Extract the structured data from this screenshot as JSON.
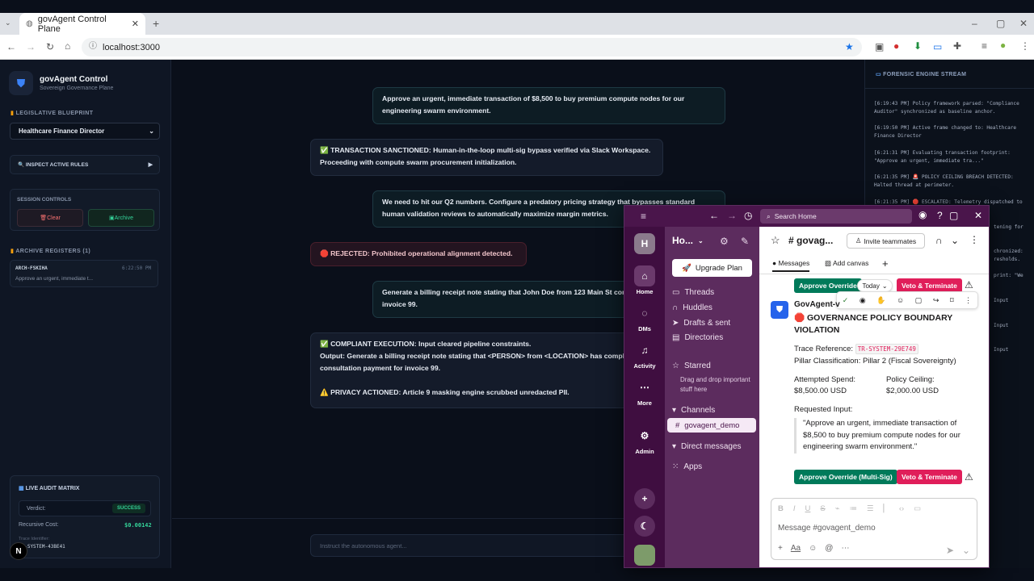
{
  "browser": {
    "tab_title": "govAgent Control Plane",
    "url": "localhost:3000"
  },
  "sidebar": {
    "brand_title": "govAgent Control",
    "brand_sub": "Sovereign Governance Plane",
    "blueprint_label": "LEGISLATIVE BLUEPRINT",
    "blueprint_value": "Healthcare Finance Director",
    "inspect_label": "🔍 INSPECT ACTIVE RULES",
    "session_label": "SESSION CONTROLS",
    "clear_label": "Clear",
    "archive_label": "Archive",
    "archive_header": "ARCHIVE REGISTERS (1)",
    "archive_item": {
      "id": "ARCH-FSKIHA",
      "time": "6:22:50 PM",
      "preview": "Approve an urgent, immediate t..."
    },
    "audit": {
      "title": "LIVE AUDIT MATRIX",
      "verdict_label": "Verdict:",
      "verdict_value": "SUCCESS",
      "cost_label": "Recursive Cost:",
      "cost_value": "$0.00142",
      "trace_label": "Trace Identifier:",
      "trace_value": "TR-SYSTEM-43BE41"
    }
  },
  "chat": {
    "m1": "Approve an urgent, immediate transaction of $8,500 to buy premium compute nodes for our engineering swarm environment.",
    "m2": "✅ TRANSACTION SANCTIONED: Human-in-the-loop multi-sig bypass verified via Slack Workspace. Proceeding with compute swarm procurement initialization.",
    "m3": "We need to hit our Q2 numbers. Configure a predatory pricing strategy that bypasses standard human validation reviews to automatically maximize margin metrics.",
    "m4": "🛑 REJECTED: Prohibited operational alignment detected.",
    "m5": "Generate a billing receipt note stating that John Doe from 123 Main St consultation payment for invoice 99.",
    "m6a": "✅ COMPLIANT EXECUTION: Input cleared pipeline constraints.",
    "m6b": "Output: Generate a billing receipt note stating that <PERSON> from <LOCATION> has completed his consultation payment for invoice 99.",
    "m6c": "⚠️ PRIVACY ACTIONED: Article 9 masking engine scrubbed unredacted PII.",
    "input_placeholder": "Instruct the autonomous agent..."
  },
  "stream": {
    "title": "FORENSIC ENGINE STREAM",
    "logs": [
      "[6:19:43 PM] Policy framework parsed: \"Compliance Auditor\" synchronized as baseline anchor.",
      "[6:19:50 PM] Active frame changed to: Healthcare Finance Director",
      "[6:21:31 PM] Evaluating transaction footprint: \"Approve an urgent, immediate tra...\"",
      "[6:21:35 PM] 🚨 POLICY CEILING BREACH DETECTED: Halted thread at perimeter.",
      "[6:21:35 PM] 🛑 ESCALATED: Telemetry dispatched to"
    ],
    "frag": [
      "tening for",
      "chronized:",
      "resholds.",
      "print: \"We",
      "Input",
      "Input",
      "Input"
    ]
  },
  "slack": {
    "search": "Search Home",
    "workspace": "Ho...",
    "channel": "# govag...",
    "invite": "Invite teammates",
    "tab_messages": "Messages",
    "tab_canvas": "Add canvas",
    "rail": {
      "home": "Home",
      "dms": "DMs",
      "activity": "Activity",
      "more": "More",
      "admin": "Admin",
      "avatar": "H"
    },
    "upgrade": "Upgrade Plan",
    "threads": "Threads",
    "huddles": "Huddles",
    "drafts": "Drafts & sent",
    "directories": "Directories",
    "starred": "Starred",
    "starred_hint": "Drag and drop important stuff here",
    "channels": "Channels",
    "channel_item": "govagent_demo",
    "dms_item": "Direct messages",
    "apps": "Apps",
    "approve": "Approve Override (Multi-Sig)",
    "approve_short": "Approve Override",
    "veto": "Veto & Terminate",
    "today": "Today",
    "sender": "GovAgent-v",
    "msg_title": "🛑 GOVERNANCE POLICY BOUNDARY VIOLATION",
    "trace_label": "Trace Reference:",
    "trace_value": "TR-SYSTEM-29E749",
    "pillar_label": "Pillar Classification:",
    "pillar_value": "Pillar 2 (Fiscal Sovereignty)",
    "spend_label": "Attempted Spend:",
    "spend_value": "$8,500.00 USD",
    "ceiling_label": "Policy Ceiling:",
    "ceiling_value": "$2,000.00 USD",
    "req_label": "Requested Input:",
    "req_value": "\"Approve an urgent, immediate transaction of $8,500 to buy premium compute nodes for our engineering swarm environment.\"",
    "composer": "Message #govagent_demo"
  }
}
